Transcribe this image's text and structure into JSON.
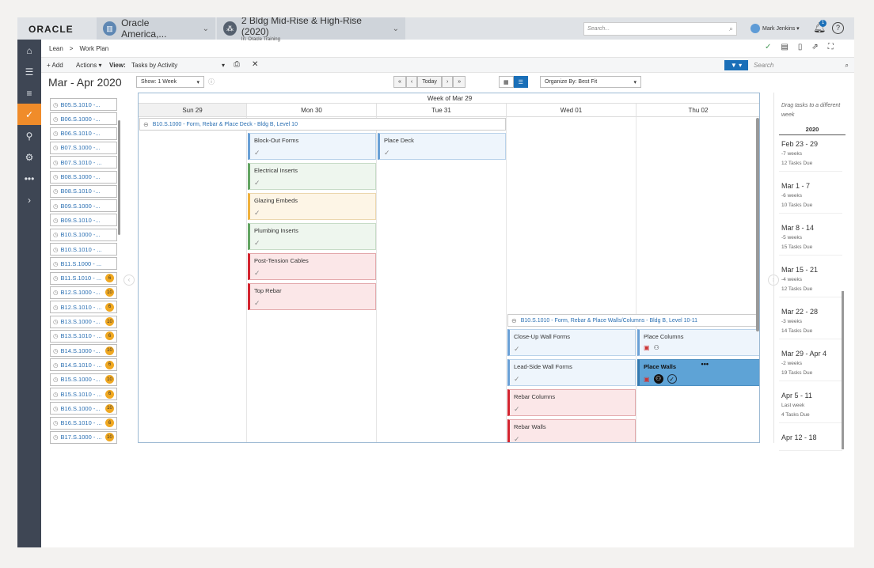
{
  "header": {
    "logo": "ORACLE",
    "company": "Oracle America,...",
    "project": "2 Bldg Mid-Rise & High-Rise (2020)",
    "project_sub": "In: Oracle Training",
    "search_placeholder": "Search...",
    "user": "Mark Jenkins ▾",
    "notifications": "1"
  },
  "nav": [
    {
      "icon": "home-icon",
      "g": "⌂"
    },
    {
      "icon": "list-icon",
      "g": "☰"
    },
    {
      "icon": "schedule-icon",
      "g": "≡"
    },
    {
      "icon": "lean-icon",
      "g": "✓",
      "active": true
    },
    {
      "icon": "network-icon",
      "g": "⚲"
    },
    {
      "icon": "settings-icon",
      "g": "⚙"
    },
    {
      "icon": "more-icon",
      "g": "•••"
    },
    {
      "icon": "expand-icon",
      "g": "›"
    }
  ],
  "breadcrumb": {
    "parent": "Lean",
    "sep": ">",
    "current": "Work Plan"
  },
  "toolbar": {
    "add": "+ Add",
    "actions": "Actions ▾",
    "view_label": "View:",
    "view_value": "Tasks by Activity",
    "search_placeholder": "Search"
  },
  "calendar": {
    "title": "Mar - Apr 2020",
    "show": "Show: 1 Week",
    "today": "Today",
    "organize": "Organize By: Best Fit",
    "week_label": "Week of Mar 29",
    "days": [
      "Sun 29",
      "Mon 30",
      "Tue 31",
      "Wed 01",
      "Thu 02"
    ]
  },
  "groups": [
    {
      "title": "B10.S.1000 - Form, Rebar & Place Deck - Bldg B, Level 10",
      "days": [
        [],
        [
          {
            "name": "Block-Out Forms",
            "color": "blue"
          },
          {
            "name": "Electrical Inserts",
            "color": "green"
          },
          {
            "name": "Glazing Embeds",
            "color": "yellow"
          },
          {
            "name": "Plumbing Inserts",
            "color": "green"
          },
          {
            "name": "Post-Tension Cables",
            "color": "red"
          },
          {
            "name": "Top Rebar",
            "color": "red"
          }
        ],
        [
          {
            "name": "Place Deck",
            "color": "blue"
          }
        ],
        [],
        []
      ]
    },
    {
      "title": "B10.S.1010 - Form, Rebar & Place Walls/Columns - Bldg B, Level 10-11",
      "days": [
        [],
        [],
        [],
        [
          {
            "name": "Close-Up Wall Forms",
            "color": "blue"
          },
          {
            "name": "Lead-Side Wall Forms",
            "color": "blue"
          },
          {
            "name": "Rebar Columns",
            "color": "red"
          },
          {
            "name": "Rebar Walls",
            "color": "red"
          }
        ],
        [
          {
            "name": "Place Columns",
            "color": "blue",
            "icons": true
          },
          {
            "name": "Place Walls",
            "color": "sel",
            "icons": true,
            "selected": true
          }
        ]
      ]
    }
  ],
  "activities": [
    {
      "id": "B05.S.1010 -..."
    },
    {
      "id": "B06.S.1000 -..."
    },
    {
      "id": "B06.S.1010 -..."
    },
    {
      "id": "B07.S.1000 -..."
    },
    {
      "id": "B07.S.1010 - ..."
    },
    {
      "id": "B08.S.1000 -..."
    },
    {
      "id": "B08.S.1010 -..."
    },
    {
      "id": "B09.S.1000 -..."
    },
    {
      "id": "B09.S.1010 -..."
    },
    {
      "id": "B10.S.1000 -..."
    },
    {
      "id": "B10.S.1010 - ..."
    },
    {
      "id": "B11.S.1000 - ..."
    },
    {
      "id": "B11.S.1010 - ...",
      "badge": "6"
    },
    {
      "id": "B12.S.1000 -...",
      "badge": "10"
    },
    {
      "id": "B12.S.1010 - ...",
      "badge": "6"
    },
    {
      "id": "B13.S.1000 -...",
      "badge": "10"
    },
    {
      "id": "B13.S.1010 - ...",
      "badge": "6"
    },
    {
      "id": "B14.S.1000 -...",
      "badge": "10"
    },
    {
      "id": "B14.S.1010 - ...",
      "badge": "6"
    },
    {
      "id": "B15.S.1000 -...",
      "badge": "10"
    },
    {
      "id": "B15.S.1010 - ...",
      "badge": "6"
    },
    {
      "id": "B16.S.1000 -...",
      "badge": "10"
    },
    {
      "id": "B16.S.1010 - ...",
      "badge": "6"
    },
    {
      "id": "B17.S.1000 - ...",
      "badge": "10"
    }
  ],
  "weeks_panel": {
    "hint": "Drag tasks to a different week",
    "year": "2020",
    "weeks": [
      {
        "range": "Feb 23 - 29",
        "rel": "-7 weeks",
        "due": "12 Tasks Due"
      },
      {
        "range": "Mar 1 - 7",
        "rel": "-6 weeks",
        "due": "10 Tasks Due"
      },
      {
        "range": "Mar 8 - 14",
        "rel": "-5 weeks",
        "due": "15 Tasks Due"
      },
      {
        "range": "Mar 15 - 21",
        "rel": "-4 weeks",
        "due": "12 Tasks Due"
      },
      {
        "range": "Mar 22 - 28",
        "rel": "-3 weeks",
        "due": "14 Tasks Due"
      },
      {
        "range": "Mar 29 - Apr 4",
        "rel": "-2 weeks",
        "due": "19 Tasks Due"
      },
      {
        "range": "Apr 5 - 11",
        "rel": "Last week",
        "due": "4 Tasks Due"
      },
      {
        "range": "Apr 12 - 18",
        "rel": "",
        "due": ""
      }
    ]
  },
  "colors": {
    "accent": "#1a6fb8",
    "nav_bg": "#3e4654",
    "nav_active": "#f08c2a",
    "badge": "#f0a821"
  }
}
